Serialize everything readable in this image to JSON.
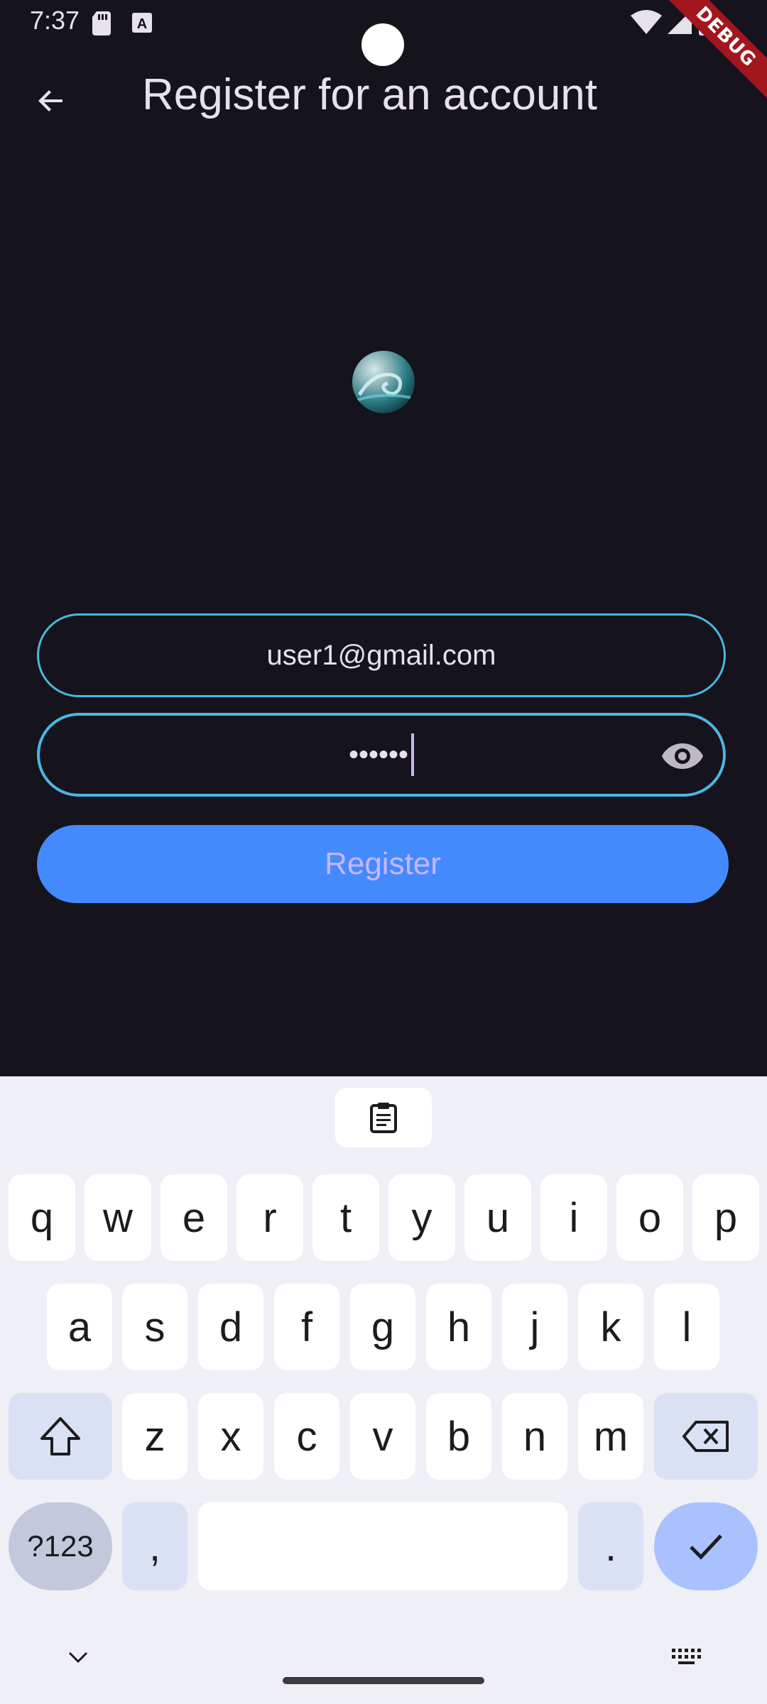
{
  "status_bar": {
    "time": "7:37",
    "icons": [
      "sd-card-icon",
      "keyboard-a-icon",
      "wifi-icon",
      "signal-icon",
      "battery-icon"
    ]
  },
  "debug_banner": "DEBUG",
  "app_bar": {
    "back_icon": "arrow-left-icon",
    "title": "Register for an account"
  },
  "form": {
    "email_value": "user1@gmail.com",
    "password_value": "••••••",
    "visibility_icon": "eye-icon",
    "submit_label": "Register"
  },
  "colors": {
    "background": "#15131b",
    "field_border": "#4bb6e3",
    "button": "#448aff",
    "button_text": "#c9b6ff"
  },
  "keyboard": {
    "clipboard_icon": "clipboard-icon",
    "row1": [
      "q",
      "w",
      "e",
      "r",
      "t",
      "y",
      "u",
      "i",
      "o",
      "p"
    ],
    "row2": [
      "a",
      "s",
      "d",
      "f",
      "g",
      "h",
      "j",
      "k",
      "l"
    ],
    "row3": [
      "z",
      "x",
      "c",
      "v",
      "b",
      "n",
      "m"
    ],
    "symbols_label": "?123",
    "comma_label": ",",
    "period_label": ".",
    "shift_icon": "shift-icon",
    "backspace_icon": "backspace-icon",
    "enter_icon": "check-icon",
    "hide_icon": "chevron-down-icon",
    "switch_icon": "keyboard-icon"
  }
}
